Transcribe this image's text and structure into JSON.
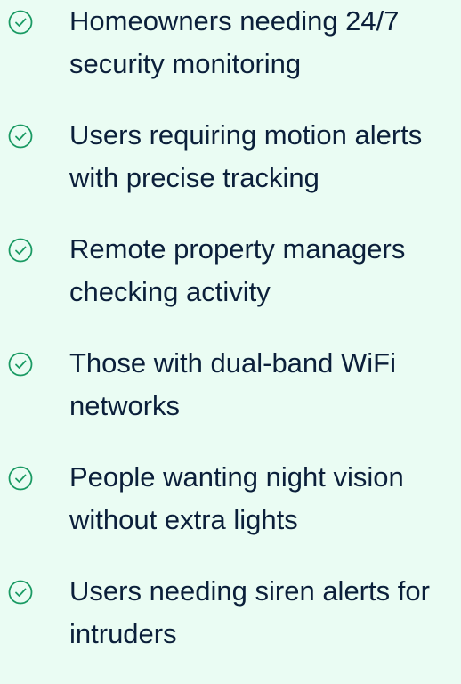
{
  "features": {
    "items": [
      {
        "icon": "check-circle-icon",
        "lines": [
          "Homeowners needing 24/7",
          "security monitoring"
        ]
      },
      {
        "icon": "check-circle-icon",
        "lines": [
          "Users requiring motion alerts",
          "with precise tracking"
        ]
      },
      {
        "icon": "check-circle-icon",
        "lines": [
          "Remote property managers",
          "checking activity"
        ]
      },
      {
        "icon": "check-circle-icon",
        "lines": [
          "Those with dual-band WiFi",
          "networks"
        ]
      },
      {
        "icon": "check-circle-icon",
        "lines": [
          "People wanting night vision",
          "without extra lights"
        ]
      },
      {
        "icon": "check-circle-icon",
        "lines": [
          "Users needing siren alerts for",
          "intruders"
        ]
      }
    ]
  },
  "colors": {
    "background": "#eafcf3",
    "text": "#0b1f3a",
    "icon": "#1a9a63"
  }
}
